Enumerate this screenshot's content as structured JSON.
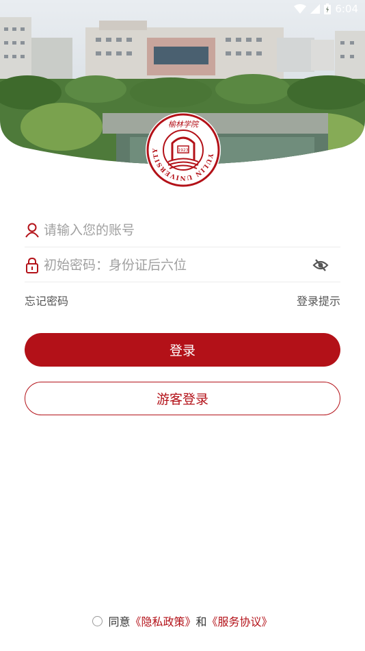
{
  "status_bar": {
    "time": "6:04",
    "wifi_icon": "wifi-icon",
    "signal_icon": "cell-signal-icon",
    "battery_icon": "battery-charging-icon"
  },
  "logo": {
    "name": "yulin-university-seal",
    "text_en": "YULIN UNIVERSITY",
    "text_cn": "榆林学院",
    "year": "1923"
  },
  "form": {
    "account_placeholder": "请输入您的账号",
    "account_icon": "user-icon",
    "password_placeholder": "初始密码：身份证后六位",
    "password_icon": "lock-icon",
    "visibility_icon": "eye-off-icon",
    "forgot_password": "忘记密码",
    "login_tips": "登录提示"
  },
  "buttons": {
    "login": "登录",
    "guest_login": "游客登录"
  },
  "agreement": {
    "prefix": "同意",
    "privacy": "《隐私政策》",
    "and": "和",
    "service": "《服务协议》"
  },
  "colors": {
    "primary": "#b31118",
    "text_gray": "#a0a0a0"
  }
}
